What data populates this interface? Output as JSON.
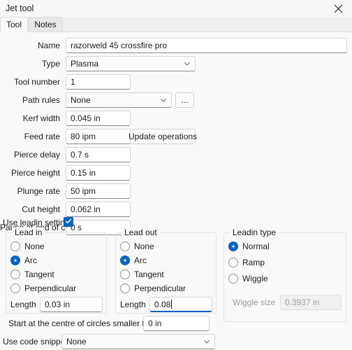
{
  "window": {
    "title": "Jet tool",
    "close_icon": "close-icon"
  },
  "tabs": [
    {
      "label": "Tool",
      "active": true
    },
    {
      "label": "Notes",
      "active": false
    }
  ],
  "form": {
    "name": {
      "label": "Name",
      "value": "razorweld 45 crossfire pro"
    },
    "type": {
      "label": "Type",
      "value": "Plasma"
    },
    "tool_number": {
      "label": "Tool number",
      "value": "1"
    },
    "path_rules": {
      "label": "Path rules",
      "value": "None",
      "browse_label": "..."
    },
    "kerf_width": {
      "label": "Kerf width",
      "value": "0.045 in"
    },
    "feed_rate": {
      "label": "Feed rate",
      "value": "80 ipm",
      "button_label": "Update operations"
    },
    "pierce_delay": {
      "label": "Pierce delay",
      "value": "0.7 s"
    },
    "pierce_height": {
      "label": "Pierce height",
      "value": "0.15 in"
    },
    "plunge_rate": {
      "label": "Plunge rate",
      "value": "50 ipm"
    },
    "cut_height": {
      "label": "Cut height",
      "value": "0.062 in"
    },
    "pause_end_cut": {
      "label": "Pause at end of cut",
      "value": "0 s"
    }
  },
  "use_leadin_settings": {
    "label": "Use leadin settings",
    "checked": true
  },
  "lead_in": {
    "title": "Lead in",
    "options": [
      {
        "label": "None",
        "selected": false
      },
      {
        "label": "Arc",
        "selected": true
      },
      {
        "label": "Tangent",
        "selected": false
      },
      {
        "label": "Perpendicular",
        "selected": false
      }
    ],
    "length": {
      "label": "Length",
      "value": "0.03 in",
      "focused": false
    }
  },
  "lead_out": {
    "title": "Lead out",
    "options": [
      {
        "label": "None",
        "selected": false
      },
      {
        "label": "Arc",
        "selected": true
      },
      {
        "label": "Tangent",
        "selected": false
      },
      {
        "label": "Perpendicular",
        "selected": false
      }
    ],
    "length": {
      "label": "Length",
      "value": "0.08",
      "focused": true
    }
  },
  "leadin_type": {
    "title": "Leadin type",
    "options": [
      {
        "label": "Normal",
        "selected": true
      },
      {
        "label": "Ramp",
        "selected": false
      },
      {
        "label": "Wiggle",
        "selected": false
      }
    ],
    "wiggle_size": {
      "label": "Wiggle size",
      "value": "0.3937 in",
      "disabled": true
    }
  },
  "footer": {
    "start_centre": {
      "label": "Start at the centre of circles smaller than",
      "value": "0 in"
    },
    "code_snippet": {
      "label": "Use code snippet",
      "value": "None"
    }
  },
  "colors": {
    "accent": "#0a62bf",
    "window_bg": "#f7f7f7",
    "panel_bg": "#f9f9f9",
    "field_bg": "#ffffff"
  }
}
